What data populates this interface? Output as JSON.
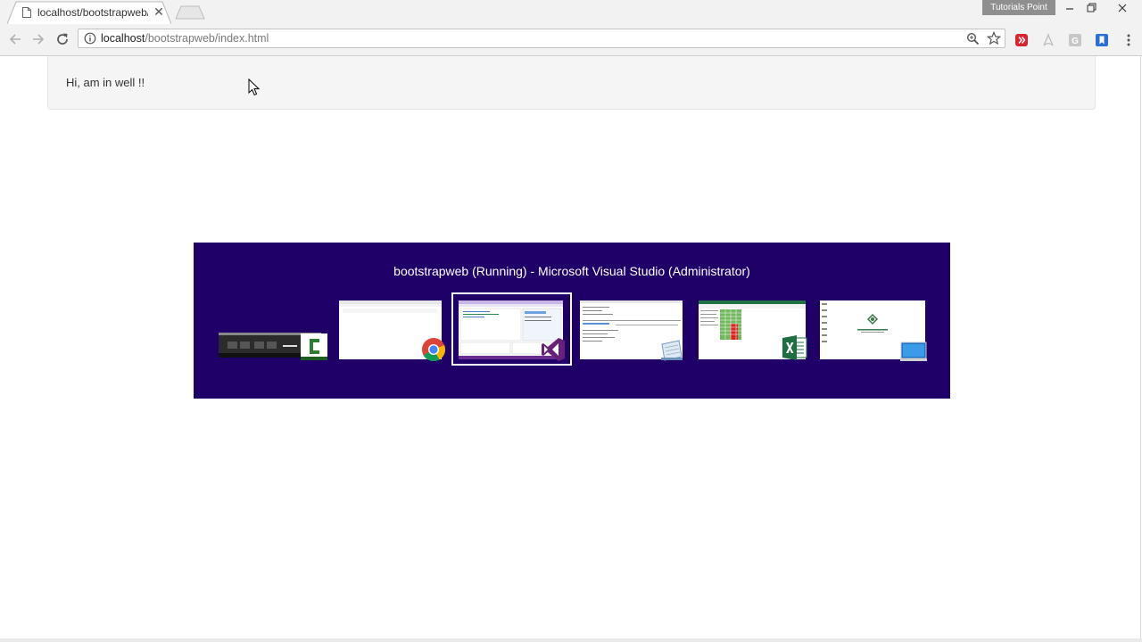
{
  "browser": {
    "tab_title": "localhost/bootstrapweb/",
    "profile_label": "Tutorials Point",
    "url_host": "localhost",
    "url_path": "/bootstrapweb/index.html"
  },
  "page": {
    "well_text": "Hi, am in well !!"
  },
  "switcher": {
    "title": "bootstrapweb (Running) - Microsoft Visual Studio (Administrator)",
    "windows": [
      {
        "app": "camtasia",
        "icon": "camtasia-icon"
      },
      {
        "app": "chrome",
        "icon": "chrome-icon"
      },
      {
        "app": "visual-studio",
        "icon": "visual-studio-icon",
        "selected": true
      },
      {
        "app": "notepad",
        "icon": "notepad-icon"
      },
      {
        "app": "excel",
        "icon": "excel-icon"
      },
      {
        "app": "remote-desktop",
        "icon": "remote-desktop-icon"
      }
    ]
  },
  "colors": {
    "switcher_bg": "#1f0068",
    "chrome_bg": "#f2f2f2",
    "well_bg": "#f5f5f5"
  }
}
